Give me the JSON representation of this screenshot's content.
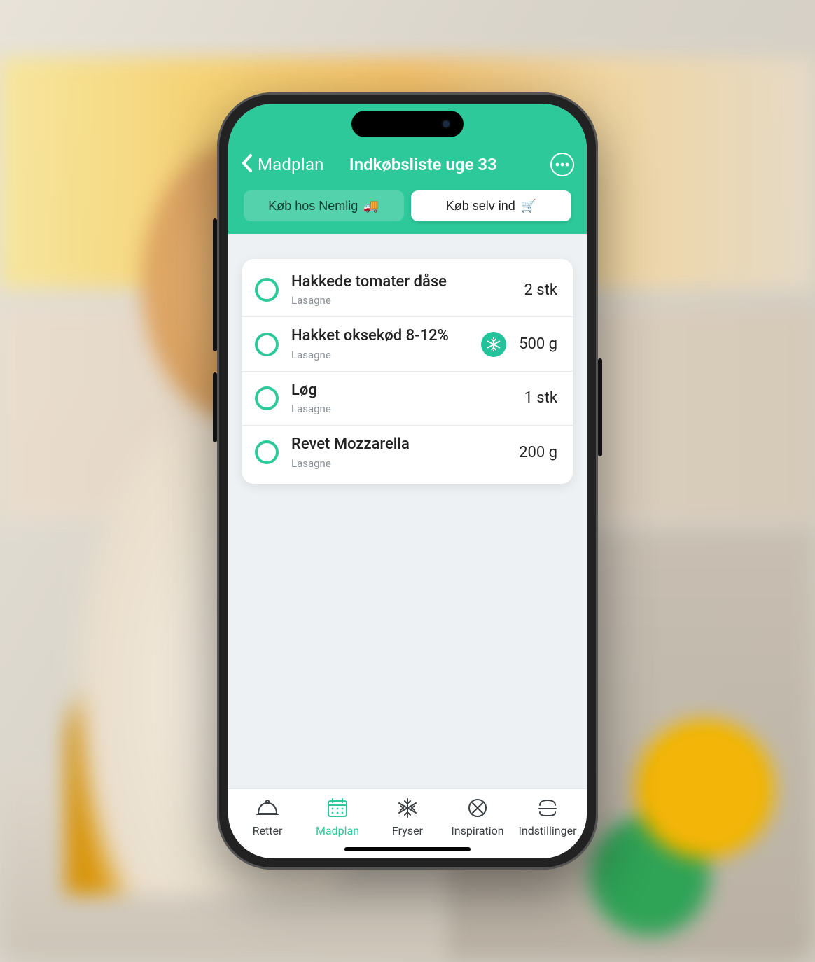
{
  "header": {
    "back_label": "Madplan",
    "title": "Indkøbsliste uge 33"
  },
  "segments": {
    "buy_nemlig": "Køb hos Nemlig",
    "buy_nemlig_emoji": "🚚",
    "buy_self": "Køb selv ind",
    "buy_self_emoji": "🛒"
  },
  "items": [
    {
      "name": "Hakkede tomater dåse",
      "source": "Lasagne",
      "qty": "2 stk",
      "freezer": false
    },
    {
      "name": "Hakket oksekød 8-12%",
      "source": "Lasagne",
      "qty": "500 g",
      "freezer": true
    },
    {
      "name": "Løg",
      "source": "Lasagne",
      "qty": "1 stk",
      "freezer": false
    },
    {
      "name": "Revet Mozzarella",
      "source": "Lasagne",
      "qty": "200 g",
      "freezer": false
    }
  ],
  "tabs": {
    "retter": "Retter",
    "madplan": "Madplan",
    "fryser": "Fryser",
    "inspiration": "Inspiration",
    "indstillinger": "Indstillinger",
    "active": "madplan"
  },
  "colors": {
    "accent": "#2ec99a"
  }
}
